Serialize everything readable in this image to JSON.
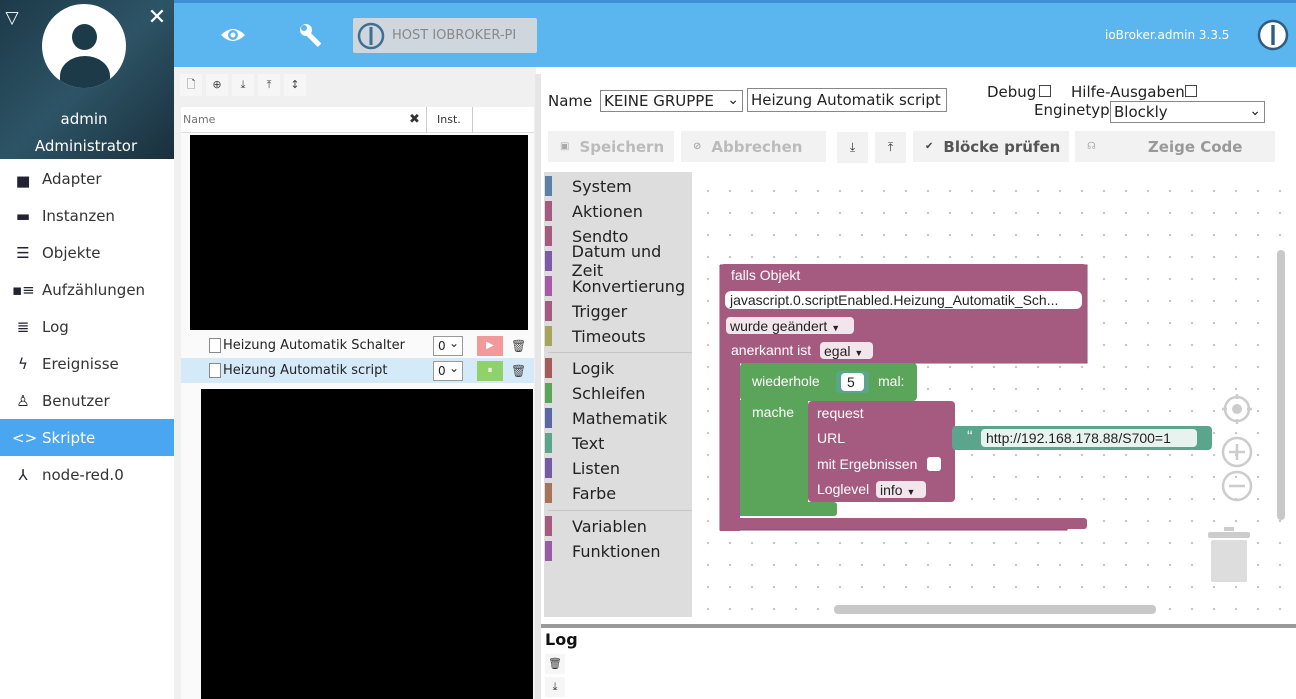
{
  "sidebar": {
    "user": {
      "name": "admin",
      "role": "Administrator"
    },
    "items": [
      {
        "label": "Adapter",
        "icon": "store-icon"
      },
      {
        "label": "Instanzen",
        "icon": "instances-icon"
      },
      {
        "label": "Objekte",
        "icon": "list-icon"
      },
      {
        "label": "Aufzählungen",
        "icon": "enum-icon"
      },
      {
        "label": "Log",
        "icon": "lines-icon"
      },
      {
        "label": "Ereignisse",
        "icon": "bolt-icon"
      },
      {
        "label": "Benutzer",
        "icon": "user-icon"
      },
      {
        "label": "Skripte",
        "icon": "code-icon",
        "active": true
      },
      {
        "label": "node-red.0",
        "icon": "node-red-icon"
      }
    ]
  },
  "header": {
    "host_label": "HOST IOBROKER-PI",
    "version": "ioBroker.admin 3.3.5"
  },
  "scripts_panel": {
    "filter_placeholder": "Name",
    "col_instance": "Inst.",
    "rows": [
      {
        "name": "Heizung Automatik Schalter",
        "instance": "0",
        "state": "stopped",
        "run_icon": "▶",
        "selected": false
      },
      {
        "name": "Heizung Automatik script",
        "instance": "0",
        "state": "running",
        "run_icon": "⏸",
        "selected": true
      }
    ]
  },
  "editor": {
    "name_label": "Name",
    "group_value": "KEINE GRUPPE",
    "script_name": "Heizung Automatik script",
    "debug_label": "Debug",
    "hilfe_label": "Hilfe-Ausgaben",
    "enginetyp_label": "Enginetyp",
    "engine_value": "Blockly",
    "save_label": "Speichern",
    "cancel_label": "Abbrechen",
    "check_label": "Blöcke prüfen",
    "show_code_label": "Zeige Code"
  },
  "toolbox": {
    "group1": [
      {
        "label": "System",
        "color": "#5b80a5"
      },
      {
        "label": "Aktionen",
        "color": "#a55b80"
      },
      {
        "label": "Sendto",
        "color": "#a55b80"
      },
      {
        "label": "Datum und Zeit",
        "color": "#805ba5"
      },
      {
        "label": "Konvertierung",
        "color": "#a55ba5"
      },
      {
        "label": "Trigger",
        "color": "#a55b80"
      },
      {
        "label": "Timeouts",
        "color": "#a5a55b"
      }
    ],
    "group2": [
      {
        "label": "Logik",
        "color": "#a55b5b"
      },
      {
        "label": "Schleifen",
        "color": "#5ba55b"
      },
      {
        "label": "Mathematik",
        "color": "#5b67a5"
      },
      {
        "label": "Text",
        "color": "#5ba58c"
      },
      {
        "label": "Listen",
        "color": "#745ba5"
      },
      {
        "label": "Farbe",
        "color": "#a5745b"
      }
    ],
    "group3": [
      {
        "label": "Variablen",
        "color": "#a55b80"
      },
      {
        "label": "Funktionen",
        "color": "#995ba5"
      }
    ]
  },
  "blocks": {
    "trigger_title": "falls Objekt",
    "object_id": "javascript.0.scriptEnabled.Heizung_Automatik_Sch...",
    "changed": "wurde geändert",
    "ack_label": "anerkannt ist",
    "ack_value": "egal",
    "repeat_label": "wiederhole",
    "repeat_count": "5",
    "repeat_suffix": "mal:",
    "do_label": "mache",
    "request_label": "request",
    "url_label": "URL",
    "url_value": "http://192.168.178.88/S700=1",
    "results_label": "mit Ergebnissen",
    "loglevel_label": "Loglevel",
    "loglevel_value": "info",
    "colors": {
      "trigger": "#a55b80",
      "loop": "#5ba55b",
      "text": "#5ba58c"
    }
  },
  "log": {
    "title": "Log"
  }
}
